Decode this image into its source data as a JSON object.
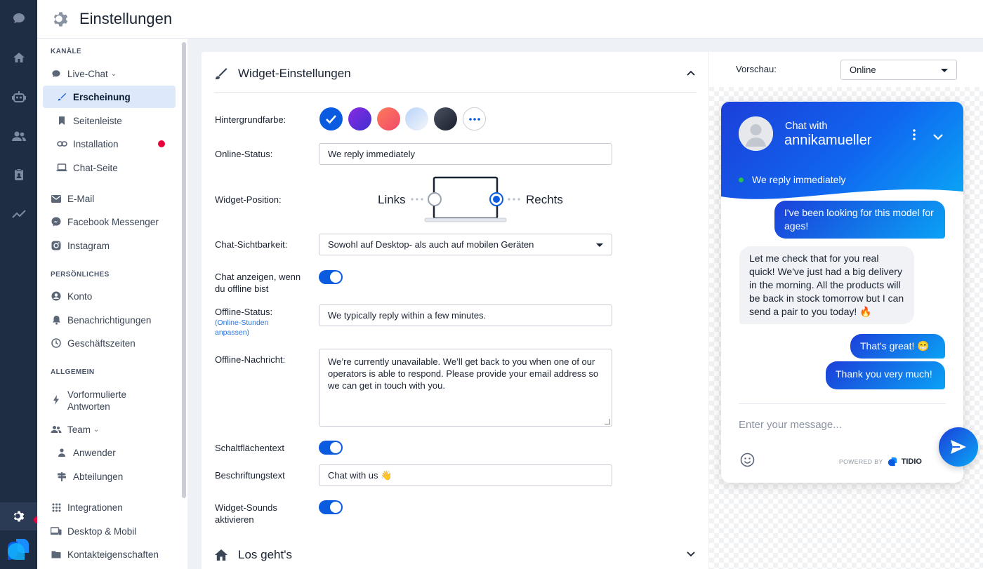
{
  "header": {
    "title": "Einstellungen"
  },
  "sidebar": {
    "sections": [
      "KANÄLE",
      "PERSÖNLICHES",
      "ALLGEMEIN"
    ],
    "items": [
      {
        "label": "Live-Chat"
      },
      {
        "label": "Erscheinung"
      },
      {
        "label": "Seitenleiste"
      },
      {
        "label": "Installation"
      },
      {
        "label": "Chat-Seite"
      },
      {
        "label": "E-Mail"
      },
      {
        "label": "Facebook Messenger"
      },
      {
        "label": "Instagram"
      },
      {
        "label": "Konto"
      },
      {
        "label": "Benachrichtigungen"
      },
      {
        "label": "Geschäftszeiten"
      },
      {
        "label": "Vorformulierte Antworten"
      },
      {
        "label": "Team"
      },
      {
        "label": "Anwender"
      },
      {
        "label": "Abteilungen"
      },
      {
        "label": "Integrationen"
      },
      {
        "label": "Desktop & Mobil"
      },
      {
        "label": "Kontakteigenschaften"
      }
    ]
  },
  "widget_settings": {
    "title": "Widget-Einstellungen",
    "labels": {
      "bg": "Hintergrundfarbe:",
      "online": "Online-Status:",
      "position": "Widget-Position:",
      "visibility": "Chat-Sichtbarkeit:",
      "offline_show": "Chat anzeigen, wenn du offline bist",
      "offline_status": "Offline-Status:",
      "offline_hours": "(Online-Stunden anpassen)",
      "offline_msg": "Offline-Nachricht:",
      "button_text": "Schaltflächentext",
      "label_text": "Beschriftungstext",
      "sounds": "Widget-Sounds aktivieren"
    },
    "colors": [
      "#0a5be0",
      "#6a2fd6",
      "#f25a5a",
      "#cfe0f7",
      "#2a3140"
    ],
    "online_status": "We reply immediately",
    "position_left": "Links",
    "position_right": "Rechts",
    "position_selected": "Rechts",
    "visibility": "Sowohl auf Desktop- als auch auf mobilen Geräten",
    "offline_status": "We typically reply within a few minutes.",
    "offline_message": "We’re currently unavailable. We’ll get back to you when one of our operators is able to respond. Please provide your email address so we can get in touch with you.",
    "label_text": "Chat with us 👋",
    "toggles": {
      "offline_show": true,
      "button_text": true,
      "sounds": true
    }
  },
  "next_section": {
    "title": "Los geht's"
  },
  "preview": {
    "label": "Vorschau:",
    "mode": "Online",
    "chat_with": "Chat with",
    "agent": "annikamueller",
    "status": "We reply immediately",
    "messages": [
      {
        "from": "visitor",
        "text": "I've been looking for this model for ages!"
      },
      {
        "from": "agent",
        "text": "Let me check that for you real quick! We've just had a big delivery in the morning. All the products will be back in stock tomorrow but I can send a pair to you today! 🔥"
      },
      {
        "from": "visitor",
        "text": "That's great! 😁"
      },
      {
        "from": "visitor",
        "text": "Thank you very much!"
      }
    ],
    "input_placeholder": "Enter your message...",
    "powered_by": "POWERED BY",
    "brand": "TIDIO"
  }
}
